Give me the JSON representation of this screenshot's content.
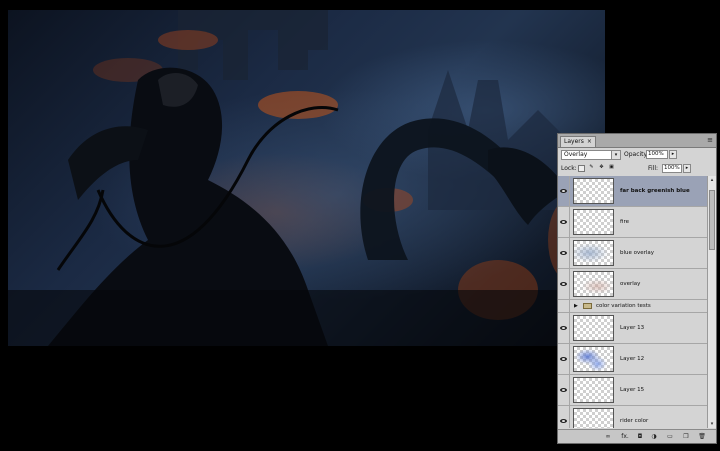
{
  "panel": {
    "tab_label": "Layers",
    "tab_close": "×",
    "menu_icon": "≡",
    "blend_mode": "Overlay",
    "blend_arrow": "▾",
    "opacity_label": "Opacity:",
    "opacity_value": "100%",
    "lock_label": "Lock:",
    "fill_label": "Fill:",
    "fill_value": "100%",
    "stepper_arrow": "▸"
  },
  "layers": [
    {
      "name": "far back greenish blue",
      "selected": true
    },
    {
      "name": "fire"
    },
    {
      "name": "blue overlay"
    },
    {
      "name": "overlay"
    },
    {
      "name": "color variation tests",
      "group": true
    },
    {
      "name": "Layer 13"
    },
    {
      "name": "Layer 12"
    },
    {
      "name": "Layer 15"
    },
    {
      "name": "rider color"
    }
  ],
  "scroll": {
    "up": "▴",
    "down": "▾"
  },
  "bottom_icons": {
    "link": "∞",
    "fx": "fx.",
    "mask": "◘",
    "adjustment": "◑",
    "folder": "▭",
    "new_layer": "❐",
    "trash": "🗑"
  }
}
